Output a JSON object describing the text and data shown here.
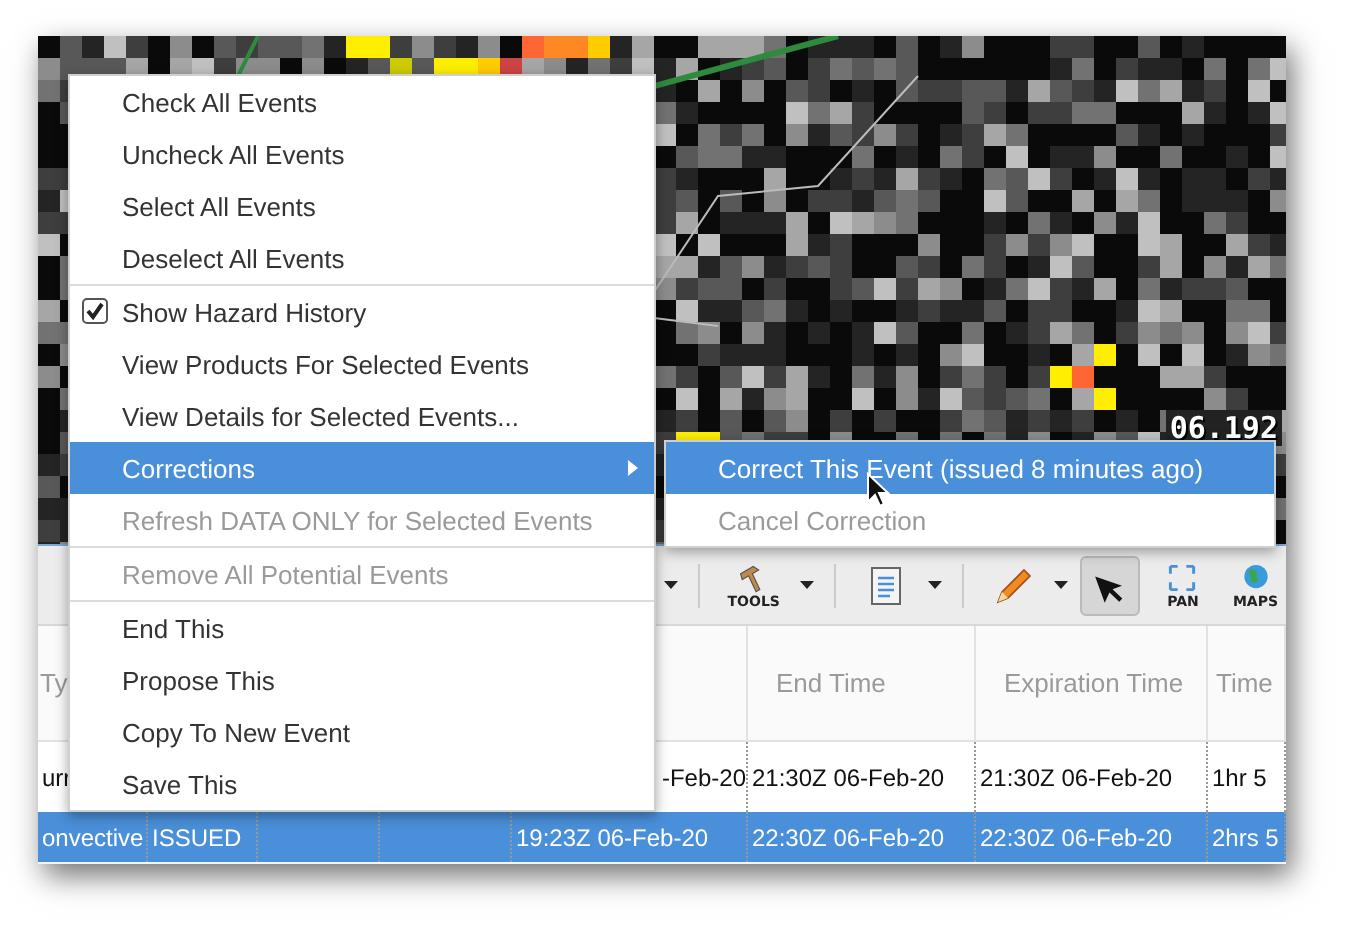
{
  "map": {
    "label": "06.192"
  },
  "toolbar": {
    "items": [
      {
        "kind": "caret"
      },
      {
        "kind": "dropdown",
        "label": "TOOLS"
      },
      {
        "kind": "dropdown"
      },
      {
        "kind": "dropdown"
      },
      {
        "kind": "toggle",
        "selected": true
      },
      {
        "kind": "button",
        "label": "PAN"
      },
      {
        "kind": "button",
        "label": "MAPS"
      }
    ]
  },
  "table": {
    "columns": {
      "column_1": "Ty",
      "column_6": "End Time",
      "column_7": "Expiration Time",
      "column_8": "Time"
    },
    "rows": [
      {
        "selected": false,
        "column_1": "urr",
        "column_5": "-Feb-20",
        "column_6": "21:30Z 06-Feb-20",
        "column_7": "21:30Z 06-Feb-20",
        "column_8": "1hr 5"
      },
      {
        "selected": true,
        "column_1": "onvective",
        "column_2": "ISSUED",
        "column_5": "19:23Z 06-Feb-20",
        "column_6": "22:30Z 06-Feb-20",
        "column_7": "22:30Z 06-Feb-20",
        "column_8": "2hrs 5"
      }
    ]
  },
  "context_menu": {
    "items": [
      {
        "kind": "action",
        "label": "Check All Events",
        "disabled": false,
        "selected": false
      },
      {
        "kind": "action",
        "label": "Uncheck All Events",
        "disabled": false,
        "selected": false
      },
      {
        "kind": "action",
        "label": "Select All Events",
        "disabled": false,
        "selected": false
      },
      {
        "kind": "action",
        "label": "Deselect All Events",
        "disabled": false,
        "selected": false
      },
      {
        "kind": "separator"
      },
      {
        "kind": "check",
        "label": "Show Hazard History",
        "checked": true,
        "disabled": false,
        "selected": false
      },
      {
        "kind": "action",
        "label": "View Products For Selected Events",
        "disabled": false,
        "selected": false
      },
      {
        "kind": "action",
        "label": "View Details for Selected Events...",
        "disabled": false,
        "selected": false
      },
      {
        "kind": "submenu",
        "label": "Corrections",
        "disabled": false,
        "selected": true
      },
      {
        "kind": "action",
        "label": "Refresh DATA ONLY for Selected Events",
        "disabled": true,
        "selected": false
      },
      {
        "kind": "separator"
      },
      {
        "kind": "action",
        "label": "Remove All Potential Events",
        "disabled": true,
        "selected": false
      },
      {
        "kind": "separator"
      },
      {
        "kind": "action",
        "label": "End This",
        "disabled": false,
        "selected": false
      },
      {
        "kind": "action",
        "label": "Propose This",
        "disabled": false,
        "selected": false
      },
      {
        "kind": "action",
        "label": "Copy To New Event",
        "disabled": false,
        "selected": false
      },
      {
        "kind": "action",
        "label": "Save This",
        "disabled": false,
        "selected": false
      }
    ]
  },
  "submenu": {
    "items": [
      {
        "kind": "action",
        "label": "Correct This Event (issued 8 minutes ago)",
        "disabled": false,
        "selected": true
      },
      {
        "kind": "action",
        "label": "Cancel Correction",
        "disabled": true,
        "selected": false
      }
    ]
  }
}
